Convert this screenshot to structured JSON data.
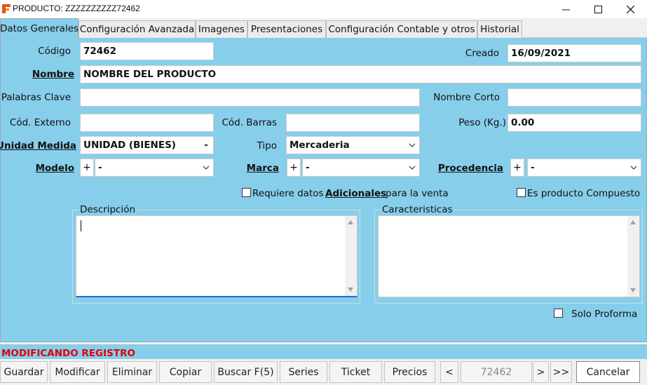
{
  "window": {
    "title": "PRODUCTO: ZZZZZZZZZZ72462",
    "minimize_icon": "minimize-icon",
    "maximize_icon": "maximize-icon",
    "close_icon": "close-icon"
  },
  "tabs": [
    {
      "label": "Datos Generales",
      "active": true
    },
    {
      "label": "Configuración Avanzada",
      "active": false
    },
    {
      "label": "Imagenes",
      "active": false
    },
    {
      "label": "Presentaciones",
      "active": false
    },
    {
      "label": "Configuración Contable y otros",
      "active": false
    },
    {
      "label": "Historial",
      "active": false
    }
  ],
  "form": {
    "codigo": {
      "label": "Código",
      "value": "72462"
    },
    "creado": {
      "label": "Creado",
      "value": "16/09/2021"
    },
    "nombre": {
      "label": "Nombre",
      "value": "NOMBRE DEL PRODUCTO"
    },
    "palabras_clave": {
      "label": "Palabras Clave",
      "value": ""
    },
    "nombre_corto": {
      "label": "Nombre Corto",
      "value": ""
    },
    "cod_externo": {
      "label": "Cód. Externo",
      "value": ""
    },
    "cod_barras": {
      "label": "Cód. Barras",
      "value": ""
    },
    "peso": {
      "label": "Peso (Kg.)",
      "value": "0.00"
    },
    "unidad_medida": {
      "label": "Unidad Medida",
      "value": "UNIDAD (BIENES)"
    },
    "tipo": {
      "label": "Tipo",
      "value": "Mercaderia"
    },
    "modelo": {
      "label": "Modelo",
      "value": "-",
      "add": "+"
    },
    "marca": {
      "label": "Marca",
      "value": "-",
      "add": "+"
    },
    "procedencia": {
      "label": "Procedencia",
      "value": "-",
      "add": "+"
    },
    "requiere_datos": {
      "prefix": "Requiere datos",
      "link": "Adicionales",
      "suffix": "para la venta",
      "checked": false
    },
    "producto_compuesto": {
      "label": "Es producto Compuesto",
      "checked": false
    },
    "descripcion": {
      "label": "Descripción",
      "value": ""
    },
    "caracteristicas": {
      "label": "Caracteristicas",
      "value": ""
    },
    "solo_proforma": {
      "label": "Solo Proforma",
      "checked": false
    }
  },
  "status": {
    "text": "MODIFICANDO REGISTRO",
    "color": "#e00000"
  },
  "toolbar": {
    "guardar": "Guardar",
    "modificar": "Modificar",
    "eliminar": "Eliminar",
    "copiar": "Copiar",
    "buscar": "Buscar F(5)",
    "series": "Series",
    "ticket": "Ticket",
    "precios": "Precios",
    "prev": "<",
    "record": "72462",
    "next": ">",
    "last": ">>",
    "cancelar": "Cancelar"
  },
  "colors": {
    "panel": "#87ceeb",
    "status": "#e00000"
  }
}
